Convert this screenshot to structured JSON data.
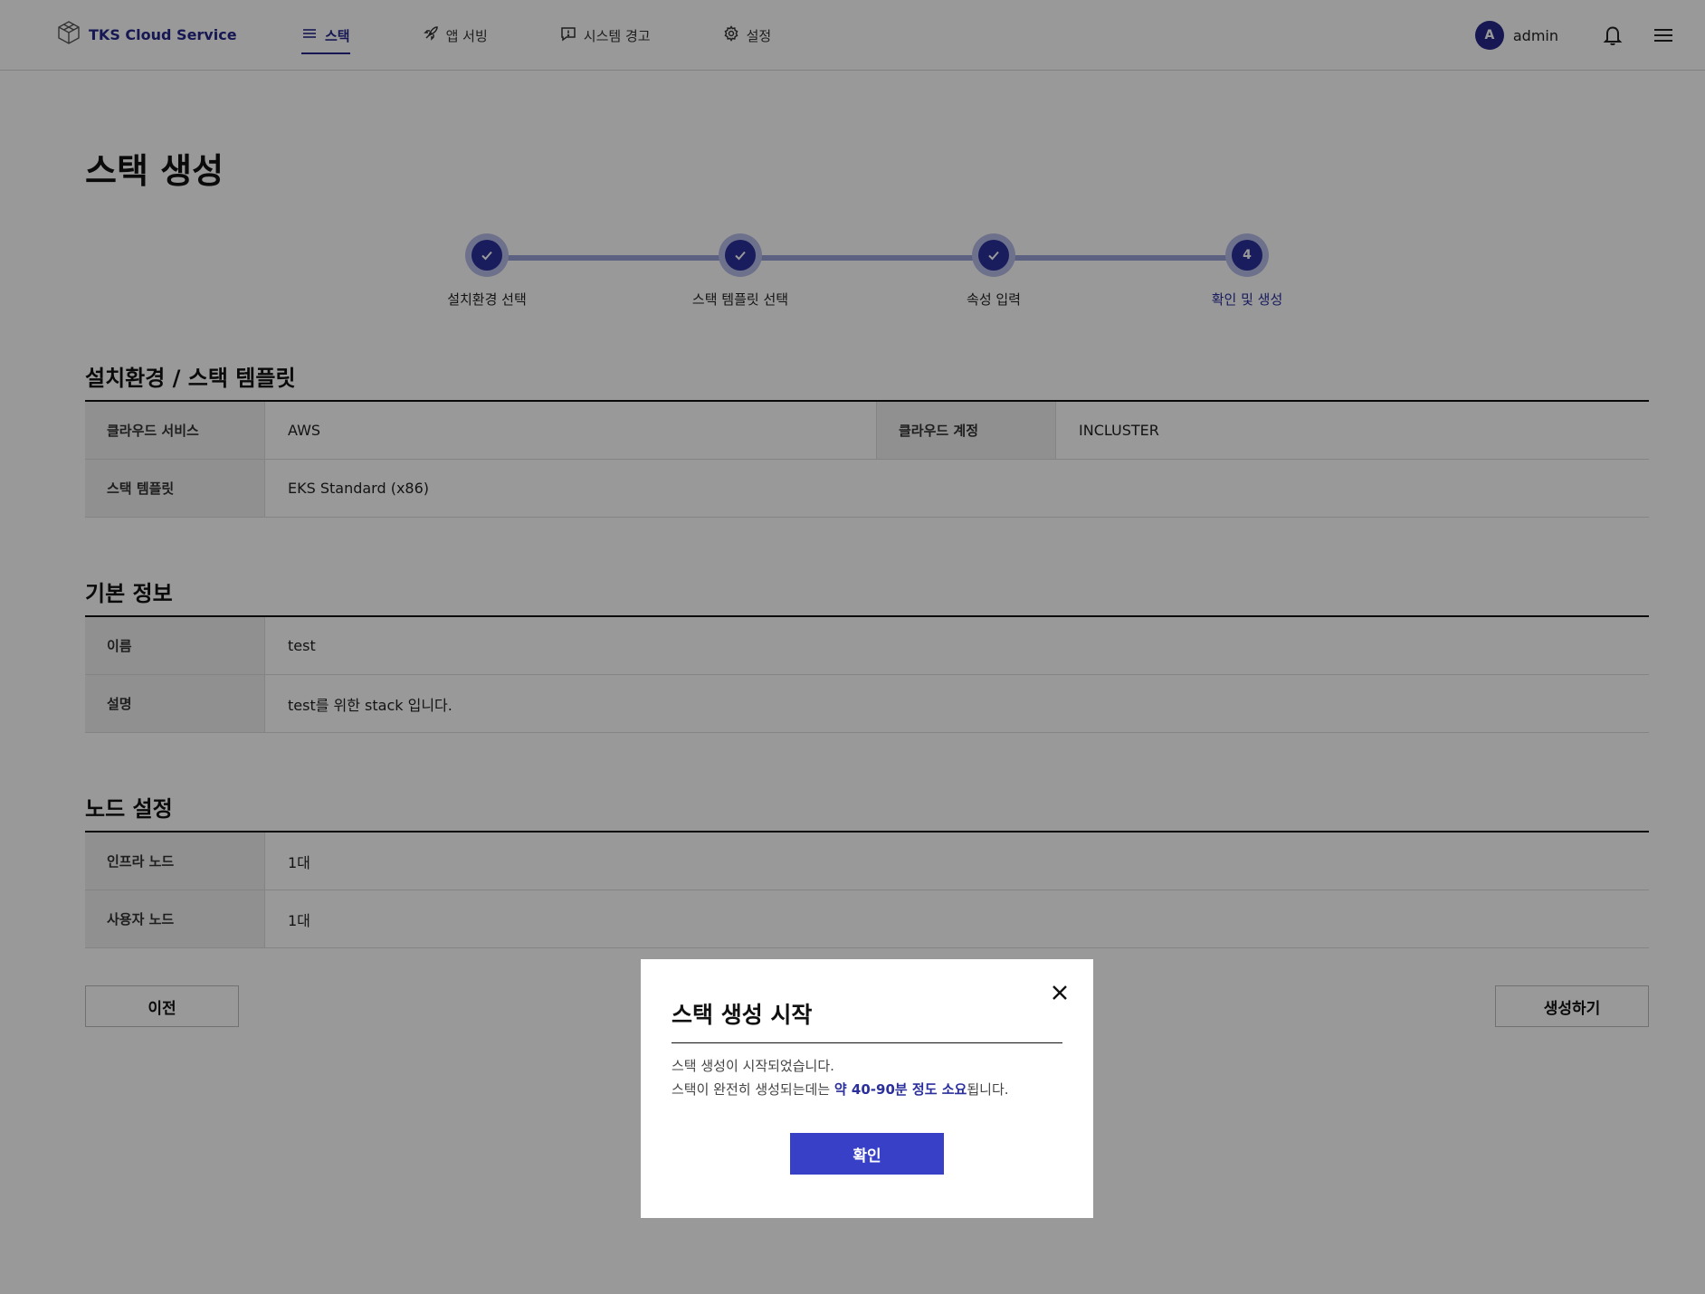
{
  "header": {
    "brand": "TKS Cloud Service",
    "nav": [
      {
        "label": "스택",
        "icon": "stack-icon",
        "active": true
      },
      {
        "label": "앱 서빙",
        "icon": "rocket-icon",
        "active": false
      },
      {
        "label": "시스템 경고",
        "icon": "alert-message-icon",
        "active": false
      },
      {
        "label": "설정",
        "icon": "gear-icon",
        "active": false
      }
    ],
    "avatar_letter": "A",
    "username": "admin"
  },
  "page": {
    "title": "스택 생성"
  },
  "stepper": {
    "steps": [
      {
        "label": "설치환경 선택",
        "state": "done"
      },
      {
        "label": "스택 템플릿 선택",
        "state": "done"
      },
      {
        "label": "속성 입력",
        "state": "done"
      },
      {
        "label": "확인 및 생성",
        "state": "current",
        "number": "4"
      }
    ]
  },
  "sections": {
    "env": {
      "title": "설치환경 / 스택 템플릿",
      "cloud_service_label": "클라우드 서비스",
      "cloud_service_value": "AWS",
      "cloud_account_label": "클라우드 계정",
      "cloud_account_value": "INCLUSTER",
      "template_label": "스택 템플릿",
      "template_value": "EKS Standard (x86)"
    },
    "basic": {
      "title": "기본 정보",
      "name_label": "이름",
      "name_value": "test",
      "desc_label": "설명",
      "desc_value": "test를 위한 stack 입니다."
    },
    "node": {
      "title": "노드 설정",
      "infra_label": "인프라 노드",
      "infra_value": "1대",
      "user_label": "사용자 노드",
      "user_value": "1대"
    }
  },
  "actions": {
    "prev": "이전",
    "create": "생성하기"
  },
  "modal": {
    "title": "스택 생성 시작",
    "line1": "스택 생성이 시작되었습니다.",
    "line2_prefix": "스택이 완전히 생성되는데는 ",
    "line2_highlight": "약 40-90분 정도 소요",
    "line2_suffix": "됩니다.",
    "confirm": "확인"
  },
  "colors": {
    "primary": "#27298a",
    "button": "#3840c8"
  }
}
